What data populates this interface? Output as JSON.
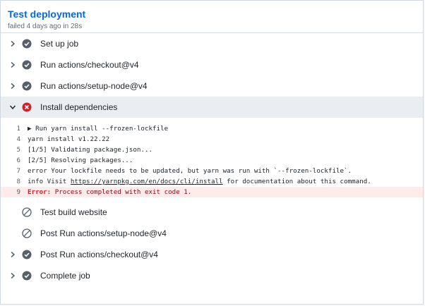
{
  "job": {
    "title": "Test deployment",
    "status": "failed 4 days ago in 28s"
  },
  "steps_before": [
    {
      "label": "Set up job",
      "state": "success"
    },
    {
      "label": "Run actions/checkout@v4",
      "state": "success"
    },
    {
      "label": "Run actions/setup-node@v4",
      "state": "success"
    }
  ],
  "active_step": {
    "label": "Install dependencies",
    "state": "failure"
  },
  "log": [
    {
      "num": "1",
      "text": "▶ Run yarn install --frozen-lockfile"
    },
    {
      "num": "4",
      "text": "yarn install v1.22.22"
    },
    {
      "num": "5",
      "text": "[1/5] Validating package.json..."
    },
    {
      "num": "6",
      "text": "[2/5] Resolving packages..."
    },
    {
      "num": "7",
      "text": "error Your lockfile needs to be updated, but yarn was run with `--frozen-lockfile`."
    },
    {
      "num": "8",
      "text_before": "info Visit ",
      "link": "https://yarnpkg.com/en/docs/cli/install",
      "text_after": " for documentation about this command."
    },
    {
      "num": "9",
      "error_label": "Error:",
      "error_msg": " Process completed with exit code 1."
    }
  ],
  "steps_after": [
    {
      "label": "Test build website",
      "state": "skipped"
    },
    {
      "label": "Post Run actions/setup-node@v4",
      "state": "skipped"
    },
    {
      "label": "Post Run actions/checkout@v4",
      "state": "success"
    },
    {
      "label": "Complete job",
      "state": "success"
    }
  ],
  "colors": {
    "success": "#57606a",
    "failure": "#cf222e",
    "link": "#0969da",
    "error_bg": "#ffebe9"
  }
}
